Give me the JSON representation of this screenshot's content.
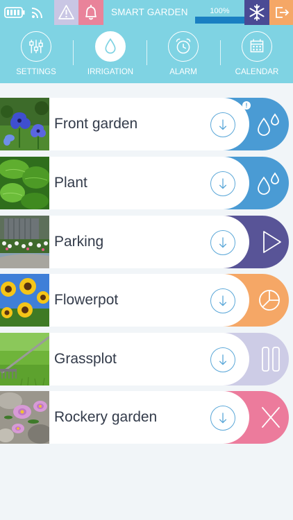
{
  "status_bar": {
    "battery_icon": "battery-icon",
    "wifi_icon": "wifi-icon",
    "warning_icon": "warning-icon",
    "bell_icon": "bell-icon",
    "title": "SMART GARDEN",
    "level_text": "100%",
    "level_fraction": 1.0,
    "snow_icon": "snowflake-icon",
    "exit_icon": "exit-icon",
    "colors": {
      "bar": "#7fd3e3",
      "warning_bg": "#c9c6e4",
      "bell_bg": "#e9839a",
      "snow_bg": "#4a4a94",
      "exit_bg": "#f5a766",
      "level": "#1a7fc2"
    }
  },
  "nav": {
    "items": [
      {
        "label": "SETTINGS",
        "icon": "sliders-icon",
        "active": false
      },
      {
        "label": "IRRIGATION",
        "icon": "water-drop-icon",
        "active": true
      },
      {
        "label": "ALARM",
        "icon": "alarm-clock-icon",
        "active": false
      },
      {
        "label": "CALENDAR",
        "icon": "calendar-icon",
        "active": false
      }
    ]
  },
  "zones": [
    {
      "name": "Front garden",
      "image": "blue-flowers",
      "action": "watering",
      "action_icon": "water-drops-icon",
      "action_color": "#4a9bd4",
      "alert": "!"
    },
    {
      "name": "Plant",
      "image": "green-leaves",
      "action": "watering",
      "action_icon": "water-drops-icon",
      "action_color": "#4a9bd4"
    },
    {
      "name": "Parking",
      "image": "driveway-flowers",
      "action": "play",
      "action_icon": "play-icon",
      "action_color": "#585497"
    },
    {
      "name": "Flowerpot",
      "image": "sunflowers",
      "action": "timer",
      "action_icon": "pie-timer-icon",
      "action_color": "#f5a766"
    },
    {
      "name": "Grassplot",
      "image": "lawn-rake",
      "action": "pause",
      "action_icon": "pause-icon",
      "action_color": "#cdcce6"
    },
    {
      "name": "Rockery garden",
      "image": "pink-daisies",
      "action": "cancel",
      "action_icon": "close-icon",
      "action_color": "#ec7b9c"
    }
  ],
  "download_icon": "download-arrow-icon"
}
